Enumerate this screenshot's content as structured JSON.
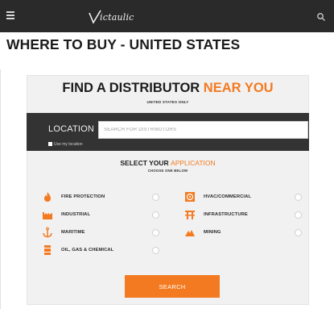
{
  "header": {
    "logo_text": "ictaulic"
  },
  "page": {
    "title": "WHERE TO BUY - UNITED STATES"
  },
  "finder": {
    "title_main": "FIND A DISTRIBUTOR ",
    "title_accent": "NEAR YOU",
    "subtitle": "UNITED STATES ONLY"
  },
  "location": {
    "label": "LOCATION",
    "placeholder": "SEARCH FOR DISTRIBUTORS",
    "value": "",
    "use_location_label": "Use my location"
  },
  "application": {
    "title_main": "SELECT YOUR ",
    "title_accent": "APPLICATION",
    "subtitle": "CHOOSE ONE BELOW",
    "options": [
      {
        "label": "FIRE PROTECTION",
        "icon": "fire-icon",
        "selected": false
      },
      {
        "label": "HVAC/COMMERCIAL",
        "icon": "hvac-icon",
        "selected": false
      },
      {
        "label": "INDUSTRIAL",
        "icon": "factory-icon",
        "selected": false
      },
      {
        "label": "INFRASTRUCTURE",
        "icon": "infrastructure-icon",
        "selected": false
      },
      {
        "label": "MARITIME",
        "icon": "anchor-icon",
        "selected": false
      },
      {
        "label": "MINING",
        "icon": "mining-icon",
        "selected": false
      },
      {
        "label": "OIL, GAS & CHEMICAL",
        "icon": "oil-barrel-icon",
        "selected": false
      }
    ]
  },
  "actions": {
    "search_label": "SEARCH"
  },
  "colors": {
    "accent": "#f37a20",
    "header_bg": "#2a2a2a",
    "location_bar_bg": "#333333",
    "card_bg": "#f1f1f1"
  }
}
